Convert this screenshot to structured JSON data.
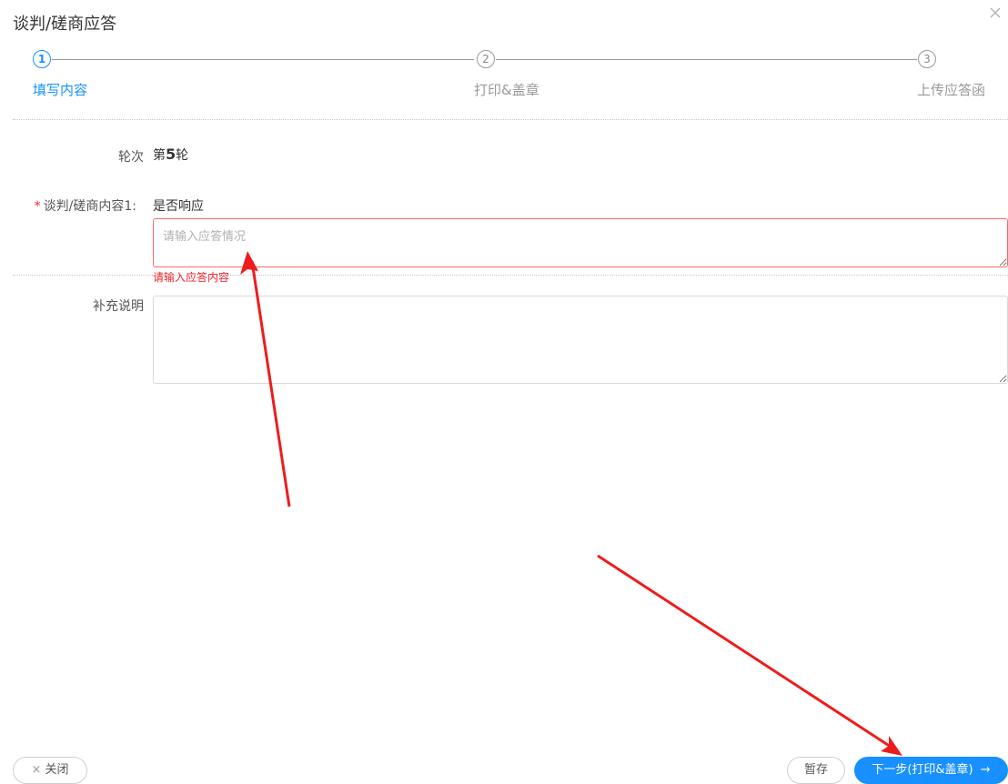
{
  "dialog": {
    "title": "谈判/磋商应答",
    "close_icon": "close-icon"
  },
  "steps": [
    {
      "number": "1",
      "label": "填写内容",
      "active": true
    },
    {
      "number": "2",
      "label": "打印&盖章",
      "active": false
    },
    {
      "number": "3",
      "label": "上传应答函",
      "active": false
    }
  ],
  "form": {
    "round_label": "轮次",
    "round_value_prefix": "第",
    "round_value_number": "5",
    "round_value_suffix": "轮",
    "content_label": "谈判/磋商内容1:",
    "content_question": "是否响应",
    "response_placeholder": "请输入应答情况",
    "response_error": "请输入应答内容",
    "supplement_label": "补充说明",
    "supplement_value": ""
  },
  "footer": {
    "close_label": "关闭",
    "save_label": "暂存",
    "next_label": "下一步(打印&盖章)"
  },
  "colors": {
    "accent": "#1890ff",
    "error": "#f5222d",
    "annotation_arrow": "#ee1c1c"
  }
}
